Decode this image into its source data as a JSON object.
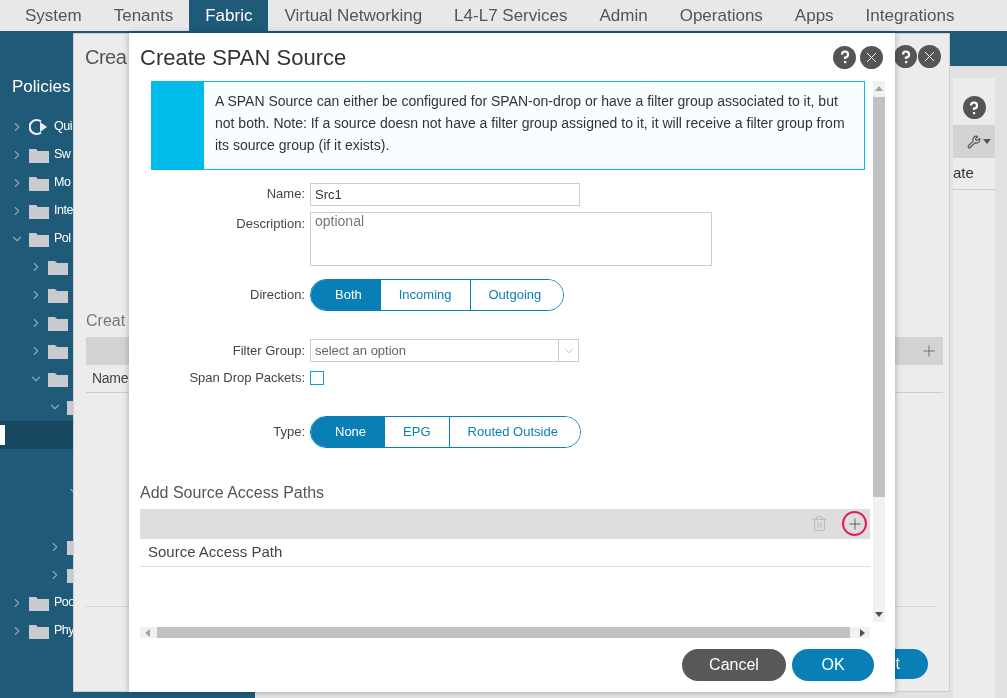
{
  "top_nav": {
    "tabs": [
      {
        "label": "System",
        "selected": false
      },
      {
        "label": "Tenants",
        "selected": false
      },
      {
        "label": "Fabric",
        "selected": true
      },
      {
        "label": "Virtual Networking",
        "selected": false
      },
      {
        "label": "L4-L7 Services",
        "selected": false
      },
      {
        "label": "Admin",
        "selected": false
      },
      {
        "label": "Operations",
        "selected": false
      },
      {
        "label": "Apps",
        "selected": false
      },
      {
        "label": "Integrations",
        "selected": false
      }
    ]
  },
  "sidebar": {
    "title": "Policies",
    "tree": [
      {
        "label": "Qui",
        "kind": "quickstart",
        "expanded": false,
        "selected": false
      },
      {
        "label": "Sw",
        "kind": "folder",
        "expanded": false,
        "selected": false
      },
      {
        "label": "Mo",
        "kind": "folder",
        "expanded": false,
        "selected": false
      },
      {
        "label": "Inte",
        "kind": "folder",
        "expanded": false,
        "selected": false
      },
      {
        "label": "Pol",
        "kind": "folder",
        "expanded": true,
        "selected": false,
        "children": [
          {
            "kind": "folder",
            "expanded": false,
            "selected": false
          },
          {
            "kind": "folder",
            "expanded": false,
            "selected": false
          },
          {
            "kind": "folder",
            "expanded": false,
            "selected": false
          },
          {
            "kind": "folder",
            "expanded": false,
            "selected": false
          },
          {
            "kind": "folder",
            "expanded": true,
            "selected": false,
            "children": [
              {
                "kind": "folder",
                "expanded": true,
                "selected": false,
                "children": [
                  {
                    "selected": true
                  },
                  {
                    "selected": false
                  },
                  {
                    "expanded": true,
                    "selected": false,
                    "children": [
                      {
                        "selected": false
                      }
                    ]
                  }
                ]
              },
              {
                "kind": "folder",
                "expanded": false,
                "selected": false
              },
              {
                "kind": "folder",
                "expanded": false,
                "selected": false
              }
            ]
          }
        ]
      },
      {
        "label": "Poo",
        "kind": "folder",
        "expanded": false,
        "selected": false
      },
      {
        "label": "Phy",
        "kind": "folder",
        "expanded": false,
        "selected": false
      }
    ]
  },
  "background_panel": {
    "column_header": "ate"
  },
  "back_dialog": {
    "title": "Crea",
    "section_title": "Creat",
    "table": {
      "columns": [
        "Name"
      ]
    },
    "buttons": [
      "t"
    ]
  },
  "dialog": {
    "title": "Create SPAN Source",
    "info": "A SPAN Source can either be configured for SPAN-on-drop or have a filter group associated to it, but not both. Note: If a source doesn not have a filter group assigned to it, it will receive a filter group from its source group (if it exists).",
    "fields": [
      {
        "kind": "text",
        "label": "Name:",
        "value": "Src1"
      },
      {
        "kind": "textarea",
        "label": "Description:",
        "placeholder": "optional"
      },
      {
        "kind": "segmented",
        "label": "Direction:",
        "options": [
          {
            "label": "Both",
            "selected": true
          },
          {
            "label": "Incoming",
            "selected": false
          },
          {
            "label": "Outgoing",
            "selected": false
          }
        ]
      },
      {
        "kind": "select",
        "label": "Filter Group:",
        "placeholder": "select an option"
      },
      {
        "kind": "checkbox",
        "label": "Span Drop Packets:",
        "checked": false
      },
      {
        "kind": "segmented",
        "label": "Type:",
        "options": [
          {
            "label": "None",
            "selected": true
          },
          {
            "label": "EPG",
            "selected": false
          },
          {
            "label": "Routed Outside",
            "selected": false
          }
        ]
      }
    ],
    "section_title": "Add Source Access Paths",
    "table": {
      "columns": [
        "Source Access Path"
      ]
    },
    "buttons": [
      {
        "label": "Cancel",
        "kind": "secondary"
      },
      {
        "label": "OK",
        "kind": "primary"
      }
    ]
  }
}
